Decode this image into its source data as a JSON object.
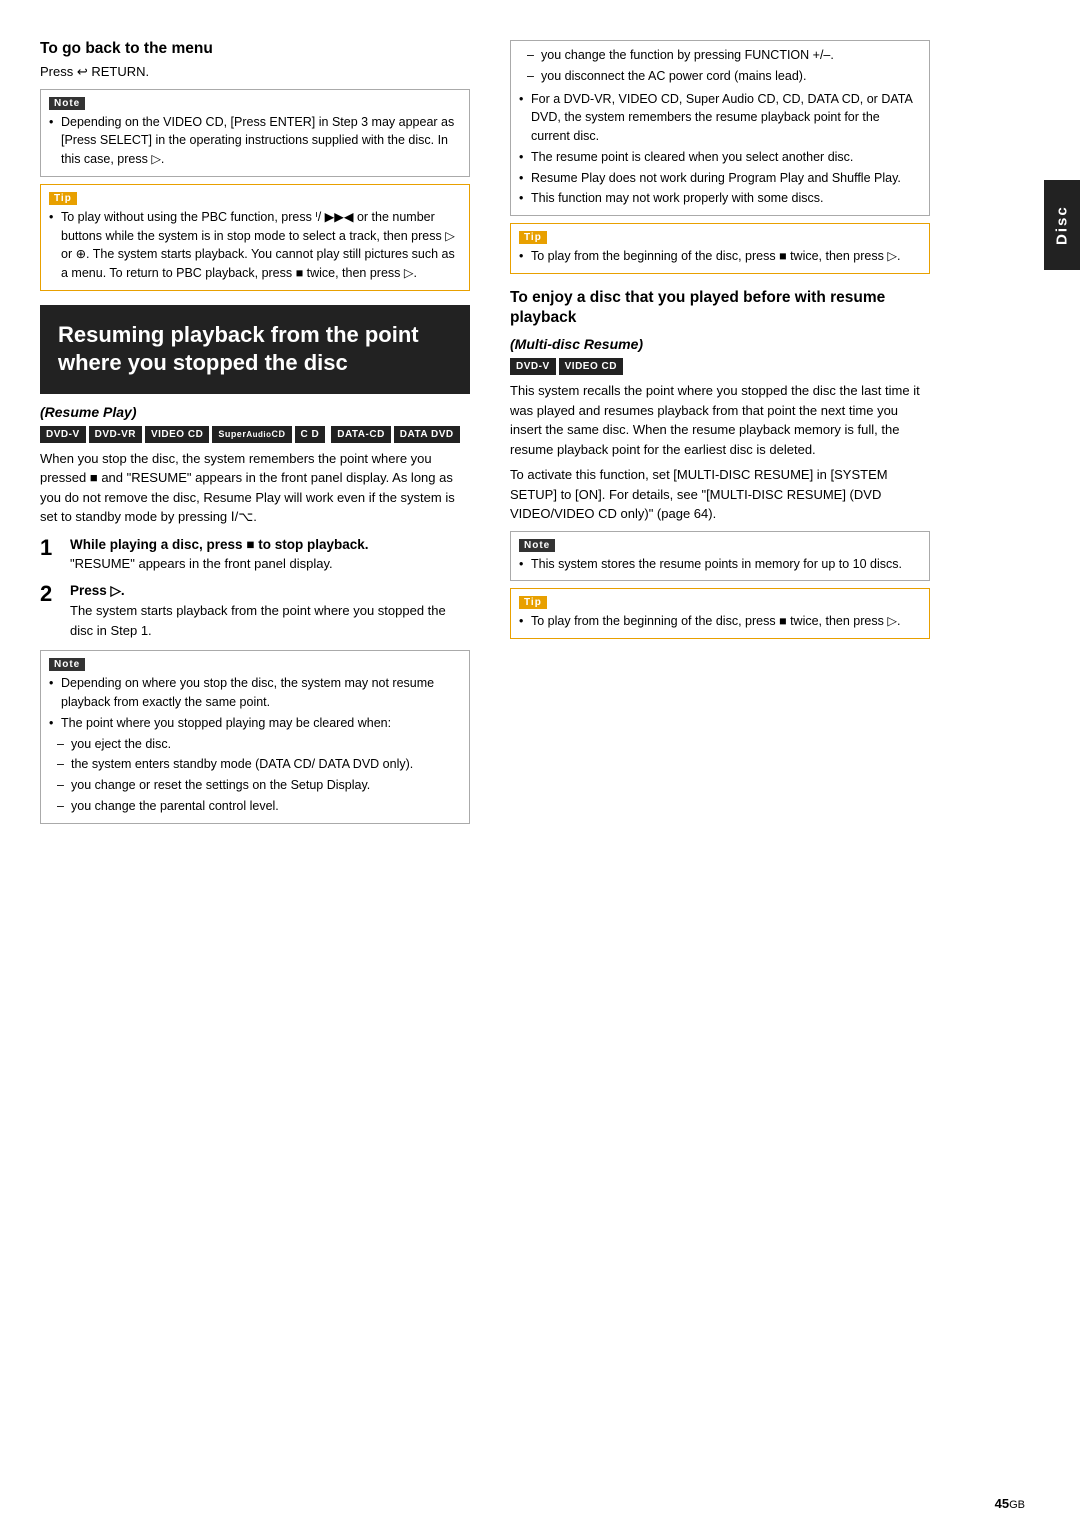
{
  "page": {
    "number": "45",
    "number_suffix": "GB",
    "side_tab": "Disc"
  },
  "left": {
    "section1": {
      "title": "To go back to the menu",
      "press_line": "Press ↩ RETURN.",
      "note_label": "Note",
      "note_bullets": [
        "Depending on the VIDEO CD, [Press ENTER] in Step 3 may appear as [Press SELECT] in the operating instructions supplied with the disc. In this case, press ▷."
      ],
      "tip_label": "Tip",
      "tip_bullets": [
        "To play without using the PBC function, press ᑊ/ ▶▶◀ or the number buttons while the system is in stop mode to select a track, then press ▷ or ⊕. The system starts playback. You cannot play still pictures such as a menu. To return to PBC playback, press ■ twice, then press ▷."
      ]
    },
    "main_heading": "Resuming playback from the point where you stopped the disc",
    "resume_play": {
      "italic_title": "(Resume Play)",
      "badges": [
        "DVD-V",
        "DVD-VR",
        "VIDEO CD",
        "SuperAudioCD",
        "C D",
        "DATA-CD",
        "DATA DVD"
      ],
      "badge_styles": [
        "dark",
        "dark",
        "dark",
        "dark",
        "dark",
        "dark",
        "dark"
      ],
      "body": "When you stop the disc, the system remembers the point where you pressed ■ and \"RESUME\" appears in the front panel display. As long as you do not remove the disc, Resume Play will work even if the system is set to standby mode by pressing Ⅰ/⌥.",
      "step1_num": "1",
      "step1_title": "While playing a disc, press ■ to stop playback.",
      "step1_body": "\"RESUME\" appears in the front panel display.",
      "step2_num": "2",
      "step2_title": "Press ▷.",
      "step2_body": "The system starts playback from the point where you stopped the disc in Step 1.",
      "note2_label": "Note",
      "note2_bullets": [
        "Depending on where you stop the disc, the system may not resume playback from exactly the same point.",
        "The point where you stopped playing may be cleared when:"
      ],
      "dash_list": [
        "you eject the disc.",
        "the system enters standby mode (DATA CD/ DATA DVD only).",
        "you change or reset the settings on the Setup Display.",
        "you change the parental control level."
      ]
    }
  },
  "right": {
    "dash_list_cont": [
      "you change the function by pressing FUNCTION +/–.",
      "you disconnect the AC power cord (mains lead)."
    ],
    "bullets_cont": [
      "For a DVD-VR, VIDEO CD, Super Audio CD, CD, DATA CD, or DATA DVD, the system remembers the resume playback point for the current disc.",
      "The resume point is cleared when you select another disc.",
      "Resume Play does not work during Program Play and Shuffle Play.",
      "This function may not work properly with some discs."
    ],
    "tip1_label": "Tip",
    "tip1_bullets": [
      "To play from the beginning of the disc, press ■ twice, then press ▷."
    ],
    "section2": {
      "title": "To enjoy a disc that you played before with resume playback",
      "italic_title": "(Multi-disc Resume)",
      "badges": [
        "DVD-V",
        "VIDEO CD"
      ],
      "badge_styles": [
        "dark",
        "dark"
      ],
      "body1": "This system recalls the point where you stopped the disc the last time it was played and resumes playback from that point the next time you insert the same disc. When the resume playback memory is full, the resume playback point for the earliest disc is deleted.",
      "body2": "To activate this function, set [MULTI-DISC RESUME] in [SYSTEM SETUP] to [ON]. For details, see \"[MULTI-DISC RESUME] (DVD VIDEO/VIDEO CD only)\" (page 64).",
      "note_label": "Note",
      "note_bullets": [
        "This system stores the resume points in memory for up to 10 discs."
      ],
      "tip2_label": "Tip",
      "tip2_bullets": [
        "To play from the beginning of the disc, press ■ twice, then press ▷."
      ]
    }
  }
}
